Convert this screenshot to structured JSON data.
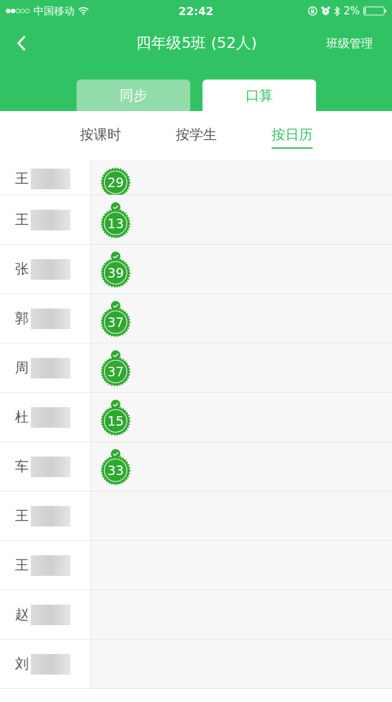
{
  "status_bar": {
    "carrier": "中国移动",
    "time": "22:42",
    "battery": "2%"
  },
  "nav": {
    "title": "四年级5班 (52人)",
    "action": "班级管理"
  },
  "tabs": [
    {
      "label": "同步",
      "selected": false
    },
    {
      "label": "口算",
      "selected": true
    }
  ],
  "subtabs": [
    {
      "label": "按课时",
      "selected": false
    },
    {
      "label": "按学生",
      "selected": false
    },
    {
      "label": "按日历",
      "selected": true
    }
  ],
  "rows": [
    {
      "surname": "王",
      "badge": {
        "count": "29",
        "checked": false
      }
    },
    {
      "surname": "王",
      "badge": {
        "count": "13",
        "checked": true
      }
    },
    {
      "surname": "张",
      "badge": {
        "count": "39",
        "checked": true
      }
    },
    {
      "surname": "郭",
      "badge": {
        "count": "37",
        "checked": true
      }
    },
    {
      "surname": "周",
      "badge": {
        "count": "37",
        "checked": true
      }
    },
    {
      "surname": "杜",
      "badge": {
        "count": "15",
        "checked": true
      }
    },
    {
      "surname": "车",
      "badge": {
        "count": "33",
        "checked": true
      }
    },
    {
      "surname": "王"
    },
    {
      "surname": "王"
    },
    {
      "surname": "赵"
    },
    {
      "surname": "刘"
    }
  ]
}
